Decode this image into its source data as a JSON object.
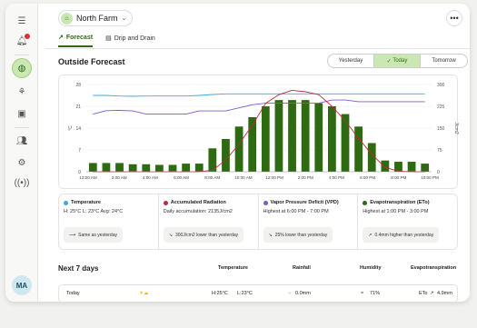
{
  "farm": {
    "name": "North Farm",
    "icon": "leaf-icon"
  },
  "tabs": [
    {
      "label": "Forecast",
      "icon": "trend-icon",
      "active": true
    },
    {
      "label": "Drip and Drain",
      "icon": "tray-icon",
      "active": false
    }
  ],
  "section_title": "Outside Forecast",
  "day_selector": [
    "Yesterday",
    "Today",
    "Tomorrow"
  ],
  "day_selected": "Today",
  "colors": {
    "accent": "#2d6a14",
    "bar": "#2e6a12",
    "radiation": "#c0283a",
    "vpd": "#7b5cc8",
    "temperature": "#3fa9df"
  },
  "chart_data": {
    "type": "bar",
    "x_labels": [
      "12:00 AM",
      "2:00 AM",
      "4:00 AM",
      "6:00 AM",
      "8:00 AM",
      "10:00 AM",
      "12:00 PM",
      "2:00 PM",
      "4:00 PM",
      "6:00 PM",
      "8:00 PM",
      "10:00 PM"
    ],
    "y_left_ticks": [
      "0",
      "7",
      "14",
      "21",
      "28"
    ],
    "y_left_label": "°C",
    "y_right_ticks": [
      "0",
      "75",
      "150",
      "225",
      "300"
    ],
    "y_right_label": "J/cm2",
    "y_left_range": [
      0,
      28
    ],
    "y_right_range": [
      0,
      300
    ],
    "series": [
      {
        "type": "bar",
        "axis": "left",
        "values": [
          2.8,
          2.8,
          2.8,
          2.4,
          2.4,
          2.2,
          2.2,
          2.6,
          2.6,
          7.5,
          10.5,
          14.5,
          17.5,
          21,
          23,
          23,
          23,
          22,
          21,
          18.5,
          14.5,
          9.2,
          3.6,
          3.2,
          3.2,
          2.6
        ]
      },
      {
        "type": "line",
        "axis": "left",
        "color": "#3fa9df",
        "values": [
          24.5,
          24.5,
          24.3,
          24.2,
          24.3,
          24.3,
          24.3,
          24.3,
          24.5,
          24.8,
          25,
          25,
          25,
          25,
          25,
          25,
          25,
          25,
          25,
          25,
          25,
          25,
          25,
          25,
          25,
          25
        ]
      },
      {
        "type": "line",
        "axis": "left",
        "color": "#7b5cc8",
        "values": [
          18.5,
          19.6,
          19.7,
          19.5,
          18.5,
          18.5,
          18.5,
          18.5,
          19.5,
          19.5,
          19.5,
          20.5,
          21.5,
          22,
          22,
          22,
          22,
          22,
          23,
          23,
          22.5,
          22.5,
          22.5,
          22.5,
          22.5,
          22.5
        ]
      },
      {
        "type": "line",
        "axis": "right",
        "color": "#c0283a",
        "values": [
          0,
          0,
          0,
          0,
          0,
          0,
          0,
          0,
          0,
          5,
          40,
          95,
          160,
          235,
          265,
          280,
          275,
          265,
          225,
          175,
          115,
          60,
          15,
          2,
          0,
          0
        ]
      }
    ]
  },
  "metrics": [
    {
      "title": "Temperature",
      "color": "#3fa9df",
      "value": "H: 25°C L: 23°C Avg: 24°C",
      "pill_icon": "arrow-right-icon",
      "pill": "Same as yesterday"
    },
    {
      "title": "Accumulated Radiation",
      "color": "#c0283a",
      "value": "Daily accumulation: 2135J/cm2",
      "pill_icon": "trend-down-icon",
      "pill": "300J/cm2 lower than yesterday"
    },
    {
      "title": "Vapor Pressure Deficit (VPD)",
      "color": "#7b5cc8",
      "value": "Highest at 6:00 PM - 7:00 PM",
      "pill_icon": "trend-down-icon",
      "pill": "25% lower than yesterday"
    },
    {
      "title": "Evapotranspiration (ETo)",
      "color": "#2e6a12",
      "value": "Highest at 1:00 PM - 3:00 PM",
      "pill_icon": "trend-up-icon",
      "pill": "0.4mm higher than yesterday"
    }
  ],
  "next7": {
    "title": "Next 7 days",
    "headers": [
      "Temperature",
      "Rainfall",
      "Humidity",
      "Evapotranspiration"
    ],
    "row": {
      "day": "Today",
      "weather_icon": "partly-sunny-icon",
      "high": "H:25°C",
      "low": "L:23°C",
      "rain": "0.0mm",
      "humidity": "71%",
      "eto_label": "ETo",
      "eto": "4.9mm"
    }
  },
  "user": {
    "initials": "MA"
  }
}
